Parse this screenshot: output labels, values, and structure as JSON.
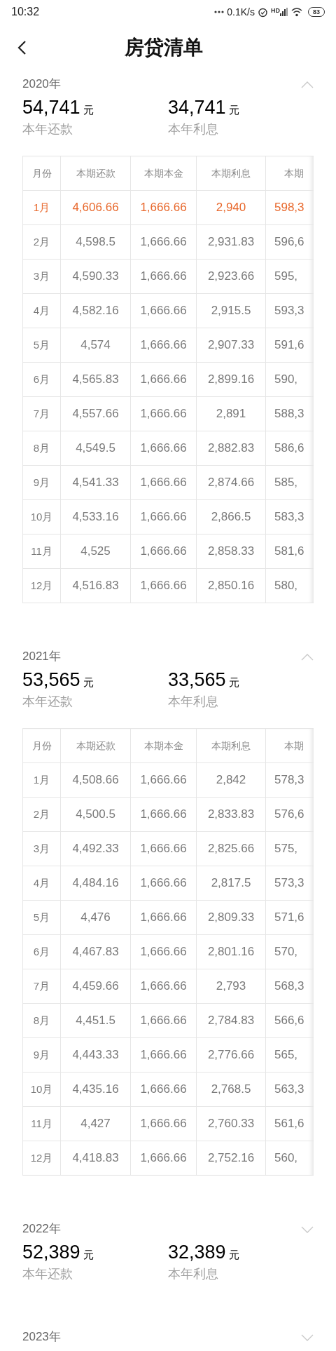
{
  "status_bar": {
    "time": "10:32",
    "speed": "0.1K/s",
    "network": "HD",
    "battery": "83"
  },
  "header": {
    "title": "房贷清单"
  },
  "years": [
    {
      "year": "2020年",
      "expanded": true,
      "repaid": "54,741",
      "repaid_unit": "元",
      "repaid_label": "本年还款",
      "interest": "34,741",
      "interest_unit": "元",
      "interest_label": "本年利息",
      "columns": [
        "月份",
        "本期还款",
        "本期本金",
        "本期利息",
        "本期"
      ],
      "rows": [
        {
          "current": true,
          "cells": [
            "1月",
            "4,606.66",
            "1,666.66",
            "2,940",
            "598,3"
          ]
        },
        {
          "current": false,
          "cells": [
            "2月",
            "4,598.5",
            "1,666.66",
            "2,931.83",
            "596,6"
          ]
        },
        {
          "current": false,
          "cells": [
            "3月",
            "4,590.33",
            "1,666.66",
            "2,923.66",
            "595,"
          ]
        },
        {
          "current": false,
          "cells": [
            "4月",
            "4,582.16",
            "1,666.66",
            "2,915.5",
            "593,3"
          ]
        },
        {
          "current": false,
          "cells": [
            "5月",
            "4,574",
            "1,666.66",
            "2,907.33",
            "591,6"
          ]
        },
        {
          "current": false,
          "cells": [
            "6月",
            "4,565.83",
            "1,666.66",
            "2,899.16",
            "590,"
          ]
        },
        {
          "current": false,
          "cells": [
            "7月",
            "4,557.66",
            "1,666.66",
            "2,891",
            "588,3"
          ]
        },
        {
          "current": false,
          "cells": [
            "8月",
            "4,549.5",
            "1,666.66",
            "2,882.83",
            "586,6"
          ]
        },
        {
          "current": false,
          "cells": [
            "9月",
            "4,541.33",
            "1,666.66",
            "2,874.66",
            "585,"
          ]
        },
        {
          "current": false,
          "cells": [
            "10月",
            "4,533.16",
            "1,666.66",
            "2,866.5",
            "583,3"
          ]
        },
        {
          "current": false,
          "cells": [
            "11月",
            "4,525",
            "1,666.66",
            "2,858.33",
            "581,6"
          ]
        },
        {
          "current": false,
          "cells": [
            "12月",
            "4,516.83",
            "1,666.66",
            "2,850.16",
            "580,"
          ]
        }
      ]
    },
    {
      "year": "2021年",
      "expanded": true,
      "repaid": "53,565",
      "repaid_unit": "元",
      "repaid_label": "本年还款",
      "interest": "33,565",
      "interest_unit": "元",
      "interest_label": "本年利息",
      "columns": [
        "月份",
        "本期还款",
        "本期本金",
        "本期利息",
        "本期"
      ],
      "rows": [
        {
          "current": false,
          "cells": [
            "1月",
            "4,508.66",
            "1,666.66",
            "2,842",
            "578,3"
          ]
        },
        {
          "current": false,
          "cells": [
            "2月",
            "4,500.5",
            "1,666.66",
            "2,833.83",
            "576,6"
          ]
        },
        {
          "current": false,
          "cells": [
            "3月",
            "4,492.33",
            "1,666.66",
            "2,825.66",
            "575,"
          ]
        },
        {
          "current": false,
          "cells": [
            "4月",
            "4,484.16",
            "1,666.66",
            "2,817.5",
            "573,3"
          ]
        },
        {
          "current": false,
          "cells": [
            "5月",
            "4,476",
            "1,666.66",
            "2,809.33",
            "571,6"
          ]
        },
        {
          "current": false,
          "cells": [
            "6月",
            "4,467.83",
            "1,666.66",
            "2,801.16",
            "570,"
          ]
        },
        {
          "current": false,
          "cells": [
            "7月",
            "4,459.66",
            "1,666.66",
            "2,793",
            "568,3"
          ]
        },
        {
          "current": false,
          "cells": [
            "8月",
            "4,451.5",
            "1,666.66",
            "2,784.83",
            "566,6"
          ]
        },
        {
          "current": false,
          "cells": [
            "9月",
            "4,443.33",
            "1,666.66",
            "2,776.66",
            "565,"
          ]
        },
        {
          "current": false,
          "cells": [
            "10月",
            "4,435.16",
            "1,666.66",
            "2,768.5",
            "563,3"
          ]
        },
        {
          "current": false,
          "cells": [
            "11月",
            "4,427",
            "1,666.66",
            "2,760.33",
            "561,6"
          ]
        },
        {
          "current": false,
          "cells": [
            "12月",
            "4,418.83",
            "1,666.66",
            "2,752.16",
            "560,"
          ]
        }
      ]
    },
    {
      "year": "2022年",
      "expanded": false,
      "repaid": "52,389",
      "repaid_unit": "元",
      "repaid_label": "本年还款",
      "interest": "32,389",
      "interest_unit": "元",
      "interest_label": "本年利息"
    },
    {
      "year": "2023年",
      "expanded": false
    }
  ]
}
